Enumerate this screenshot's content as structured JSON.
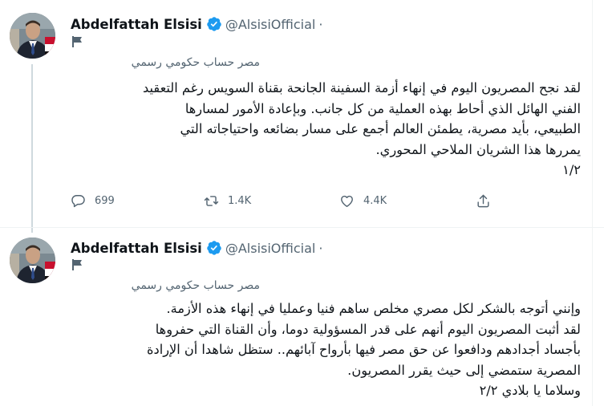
{
  "tweets": [
    {
      "author": {
        "name": "Abdelfattah Elsisi",
        "handle": "@AlsisiOfficial",
        "separator": "·",
        "gov_label": "مصر حساب حكومي رسمي"
      },
      "text_lines": [
        "لقد نجح المصريون اليوم في إنهاء أزمة السفينة الجانحة بقناة السويس رغم التعقيد",
        "الفني الهائل الذي أحاط بهذه العملية من كل جانب. وبإعادة الأمور لمسارها",
        "الطبيعي، بأيد مصرية، يطمئن العالم أجمع على مسار بضائعه واحتياجاته التي",
        "يمررها هذا الشريان الملاحي المحوري.",
        "١/٢"
      ],
      "actions": {
        "reply_count": "699",
        "retweet_count": "1.4K",
        "like_count": "4.4K"
      }
    },
    {
      "author": {
        "name": "Abdelfattah Elsisi",
        "handle": "@AlsisiOfficial",
        "separator": "·",
        "gov_label": "مصر حساب حكومي رسمي"
      },
      "text_lines": [
        "وإنني أتوجه بالشكر لكل مصري مخلص ساهم فنيا وعمليا في إنهاء هذه الأزمة.",
        "لقد أثبت المصريون اليوم أنهم على قدر المسؤولية دوما، وأن القناة التي حفروها",
        "بأجساد أجدادهم ودافعوا عن حق مصر فيها بأرواح آبائهم.. ستظل شاهدا أن الإرادة",
        "المصرية ستمضي إلى حيث يقرر المصريون.",
        "وسلاما يا بلادي ٢/٢"
      ]
    }
  ],
  "colors": {
    "text": "#0f1419",
    "secondary": "#536471",
    "verified": "#1d9bf0",
    "thread_line": "#cfd9de"
  },
  "icons": [
    "verified-badge-icon",
    "flag-icon",
    "reply-icon",
    "retweet-icon",
    "like-icon",
    "share-icon"
  ]
}
